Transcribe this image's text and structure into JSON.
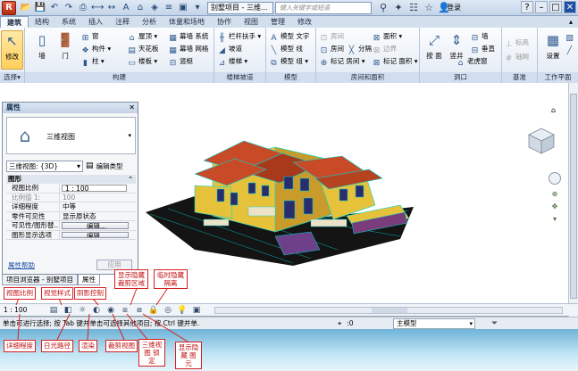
{
  "titlebar": {
    "app_button": "R",
    "document_tab": "别墅项目 - 三维...",
    "search_placeholder": "键入关键字或短语",
    "login": "登录"
  },
  "ribbon_tabs": [
    "建筑",
    "结构",
    "系统",
    "插入",
    "注释",
    "分析",
    "体量和场地",
    "协作",
    "视图",
    "管理",
    "修改"
  ],
  "ribbon": {
    "modify": "修改",
    "select": "选择",
    "build_panel": {
      "title": "构建",
      "wall": "墙",
      "door": "门",
      "window": "窗",
      "component": "构件",
      "column": "柱",
      "roof": "屋顶",
      "ceiling": "天花板",
      "floor": "楼板",
      "curtain_system": "幕墙 系统",
      "curtain_grid": "幕墙 网格",
      "mullion": "竖梃"
    },
    "circulation_panel": {
      "title": "楼梯坡道",
      "railing": "栏杆扶手",
      "ramp": "坡道",
      "stair": "楼梯"
    },
    "model_panel": {
      "title": "模型",
      "model_text": "模型 文字",
      "model_line": "模型 线",
      "model_group": "模型 组"
    },
    "room_panel": {
      "title": "房间和面积",
      "room": "房间",
      "room_separator": "分隔",
      "tag_room": "标记 房间",
      "area": "面积",
      "area_boundary": "边界",
      "tag_area": "标记 面积",
      "room_dim": "房间",
      "area_dim": "面积"
    },
    "opening_panel": {
      "title": "洞口",
      "by_face": "按 面",
      "shaft": "竖井",
      "wall_opening": "墙",
      "vertical": "垂直",
      "dormer": "老虎窗"
    },
    "datum_panel": {
      "title": "基准",
      "level": "标高",
      "grid": "轴网"
    },
    "workplane_panel": {
      "title": "工作平面",
      "set": "设置"
    }
  },
  "properties": {
    "title": "属性",
    "type_name": "三维视图",
    "filter": "三维视图: {3D}",
    "edit_type": "编辑类型",
    "group": "图形",
    "rows": [
      {
        "key": "视图比例",
        "value": "1 : 100"
      },
      {
        "key": "比例值 1:",
        "value": "100"
      },
      {
        "key": "详细程度",
        "value": "中等"
      },
      {
        "key": "零件可见性",
        "value": "显示原状态"
      },
      {
        "key": "可见性/图形替...",
        "value": "编辑..."
      },
      {
        "key": "图形显示选项",
        "value": "编辑..."
      }
    ],
    "help": "属性帮助",
    "apply": "应用"
  },
  "browser_tabs": [
    "项目浏览器 - 别墅项目",
    "属性"
  ],
  "viewbar": {
    "scale": "1 : 100"
  },
  "status": {
    "text": "单击可进行选择; 按 Tab 键并单击可选择其他项目; 按 Ctrl 键并单...",
    "count": ":0",
    "workset": "主模型"
  },
  "callouts": {
    "view_scale": "视图比例",
    "visual_style": "视觉样式",
    "shadows": "阴影控制",
    "show_crop": "显示隐藏 裁剪区域",
    "temp_hide": "临时隐藏 隔离",
    "detail_level": "详细程度",
    "sun_path": "日光路径",
    "render": "渲染",
    "crop_view": "裁剪视图",
    "lock_3d": "三维视图 锁定",
    "reveal_hidden": "显示隐藏 图元"
  },
  "colors": {
    "roof": "#c94a26",
    "wall": "#e8c63a",
    "edge": "#00d8d8",
    "callout_border": "#d42020",
    "ribbon_bg": "#e2eaf4"
  }
}
